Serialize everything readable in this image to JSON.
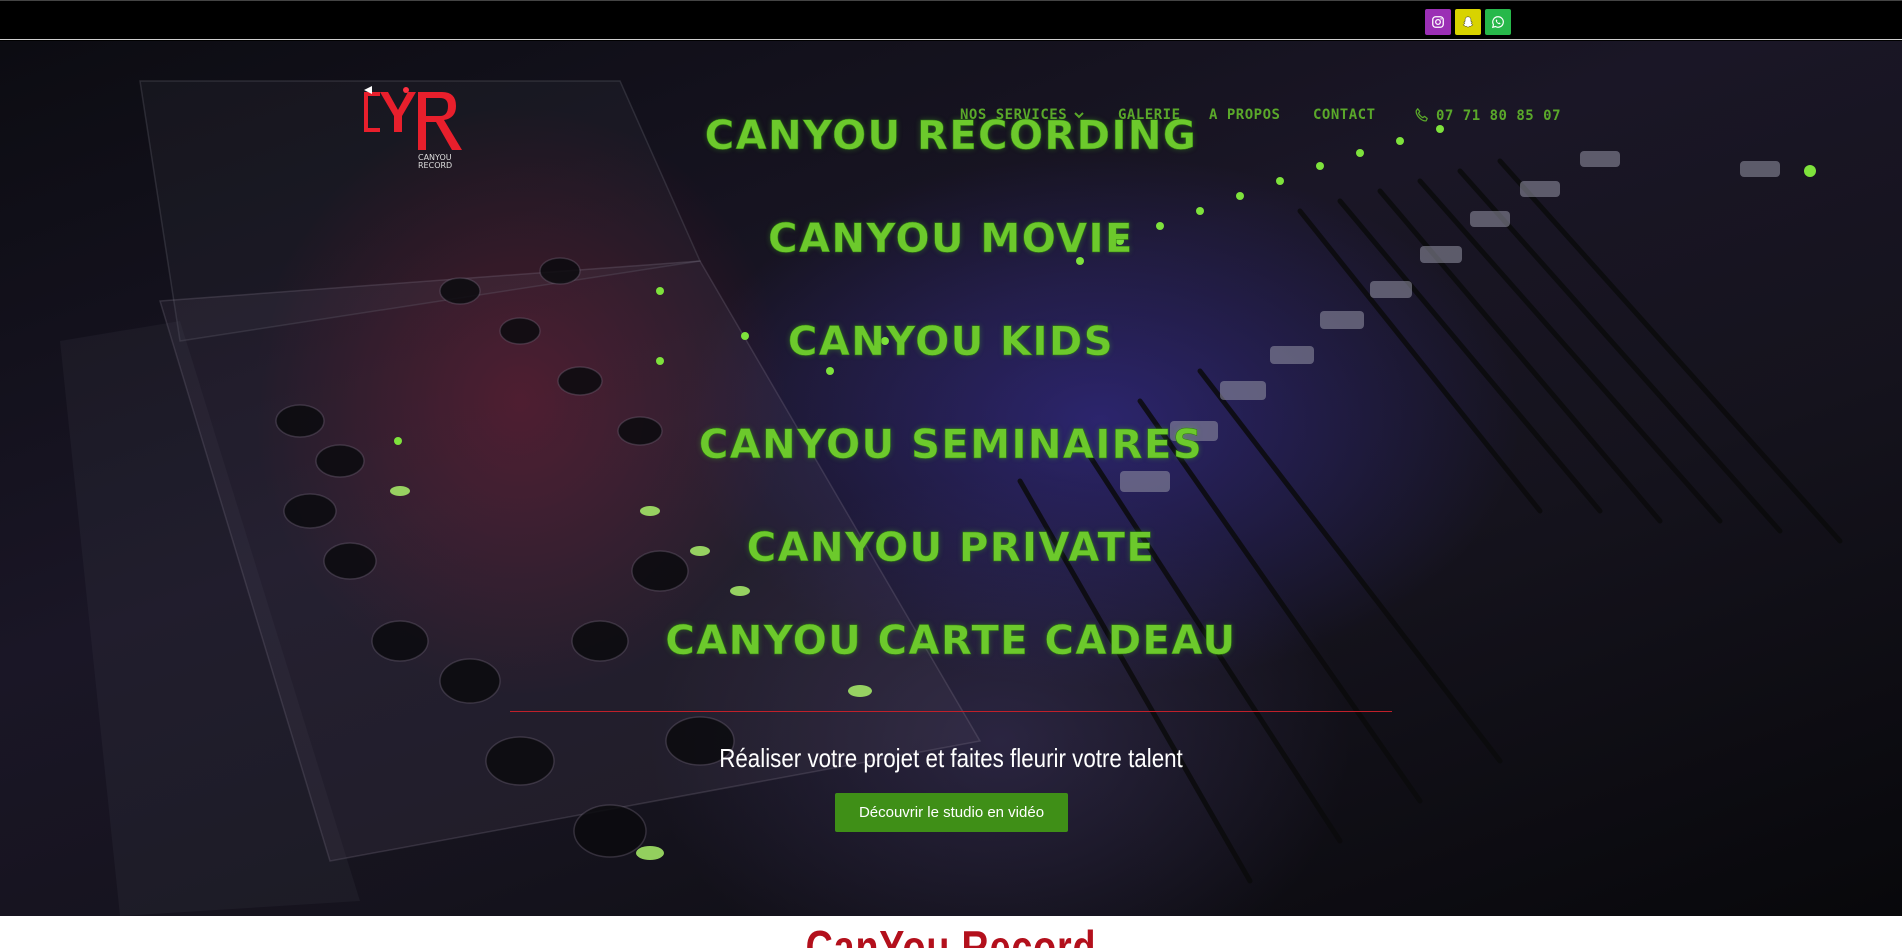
{
  "colors": {
    "accent_green": "#6cc92c",
    "nav_green": "#5aa82a",
    "cta_green": "#3f8f17",
    "brand_red": "#b3101c",
    "instagram": "#9b2fb5",
    "snapchat": "#d8d300",
    "whatsapp": "#27b84a"
  },
  "social": [
    {
      "icon": "instagram-icon"
    },
    {
      "icon": "snapchat-icon"
    },
    {
      "icon": "whatsapp-icon"
    }
  ],
  "logo": {
    "text": "CYR",
    "sub": "CANYOU RECORD"
  },
  "nav": {
    "services": "NOS SERVICES",
    "galerie": "GALERIE",
    "apropos": "A PROPOS",
    "contact": "CONTACT",
    "phone": "07 71 80 85 07",
    "phone_icon": "phone-icon",
    "chevron_icon": "chevron-down-icon"
  },
  "services": [
    "CANYOU RECORDING",
    "CANYOU MOVIE",
    "CANYOU KIDS",
    "CANYOU SEMINAIRES",
    "CANYOU PRIVATE",
    "CANYOU CARTE CADEAU"
  ],
  "tagline": "Réaliser votre projet et faites fleurir votre talent",
  "cta": "Découvrir le studio en vidéo",
  "footer_title": "CanYou Record"
}
